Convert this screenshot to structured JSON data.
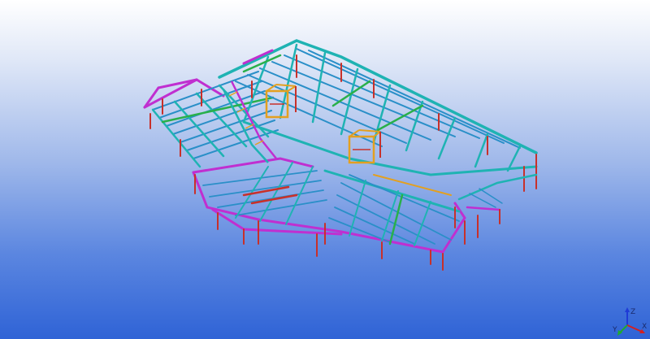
{
  "viewport": {
    "background_top": "#ffffff",
    "background_bottom": "#2f63d6"
  },
  "model": {
    "member_colors": {
      "beams": "#1fb3b3",
      "rafters": "#2a8fc8",
      "edge_beams": "#c02fd0",
      "bracing": "#29b04a",
      "columns": "#c8302a",
      "stair_frames": "#e3a020"
    }
  },
  "triad": {
    "z_label": "Z",
    "x_label": "X",
    "y_label": "Y",
    "colors": {
      "z": "#1f3bd6",
      "x": "#d32020",
      "y": "#1faa2e"
    }
  }
}
